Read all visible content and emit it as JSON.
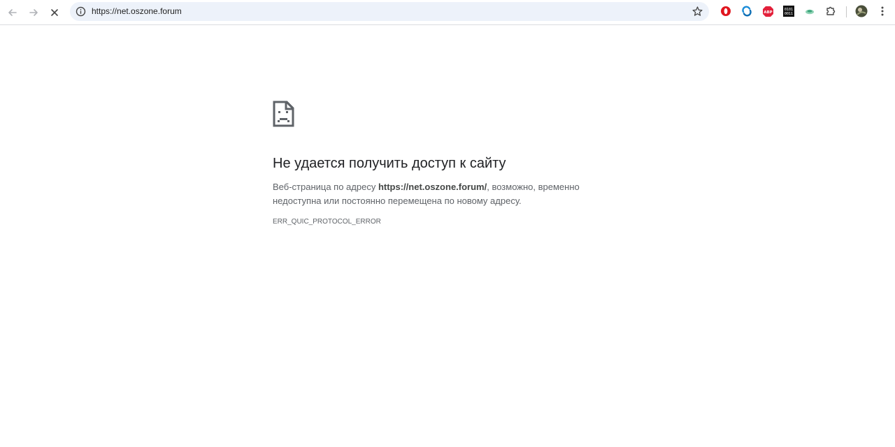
{
  "browser": {
    "url": "https://net.oszone.forum",
    "extensions": [
      "opera-icon",
      "sync-icon",
      "adblock-plus-icon",
      "binary-code-icon",
      "leaf-icon"
    ],
    "adblock_label": "ABP",
    "binary_label_1": "0101",
    "binary_label_2": "0011"
  },
  "error": {
    "title": "Не удается получить доступ к сайту",
    "desc_prefix": "Веб-страница по адресу ",
    "desc_url": "https://net.oszone.forum/",
    "desc_suffix": ", возможно, временно недоступна или постоянно перемещена по новому адресу.",
    "code": "ERR_QUIC_PROTOCOL_ERROR"
  },
  "colors": {
    "omnibox_bg": "#edf2fa",
    "heading": "#202124",
    "body_text": "#5f6368"
  }
}
